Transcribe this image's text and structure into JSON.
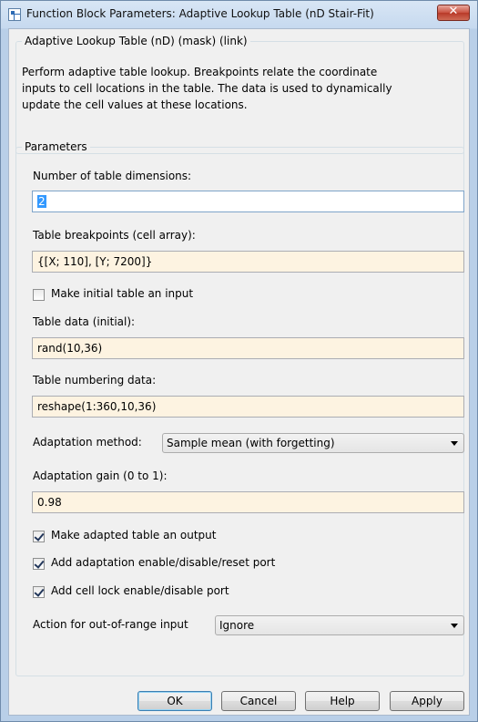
{
  "window": {
    "title": "Function Block Parameters: Adaptive Lookup Table (nD Stair-Fit)",
    "close_glyph": "✕"
  },
  "description": {
    "group_title": "Adaptive Lookup Table (nD) (mask) (link)",
    "text": "Perform adaptive table lookup.  Breakpoints relate the coordinate\ninputs to cell locations in the table.  The data is used to dynamically\nupdate the cell values at these locations."
  },
  "parameters": {
    "group_title": "Parameters",
    "num_dims_label": "Number of table dimensions:",
    "num_dims_value": "2",
    "breakpoints_label": "Table breakpoints (cell array):",
    "breakpoints_value": "{[X; 110], [Y; 7200]}",
    "initial_input_label": "Make initial table an input",
    "initial_input_checked": false,
    "table_data_label": "Table data (initial):",
    "table_data_value": "rand(10,36)",
    "numbering_label": "Table numbering data:",
    "numbering_value": "reshape(1:360,10,36)",
    "method_label": "Adaptation method:",
    "method_value": "Sample mean (with forgetting)",
    "gain_label": "Adaptation gain (0 to 1):",
    "gain_value": "0.98",
    "output_label": "Make adapted table an output",
    "output_checked": true,
    "enable_port_label": "Add adaptation enable/disable/reset port",
    "enable_port_checked": true,
    "cell_lock_label": "Add cell lock enable/disable port",
    "cell_lock_checked": true,
    "out_of_range_label": "Action for out-of-range input",
    "out_of_range_value": "Ignore"
  },
  "buttons": {
    "ok": "OK",
    "cancel": "Cancel",
    "help": "Help",
    "apply": "Apply"
  },
  "icons": {
    "window": "simulink-block-icon",
    "close": "close-icon",
    "dropdown": "chevron-down-icon",
    "check": "checkmark-icon"
  }
}
